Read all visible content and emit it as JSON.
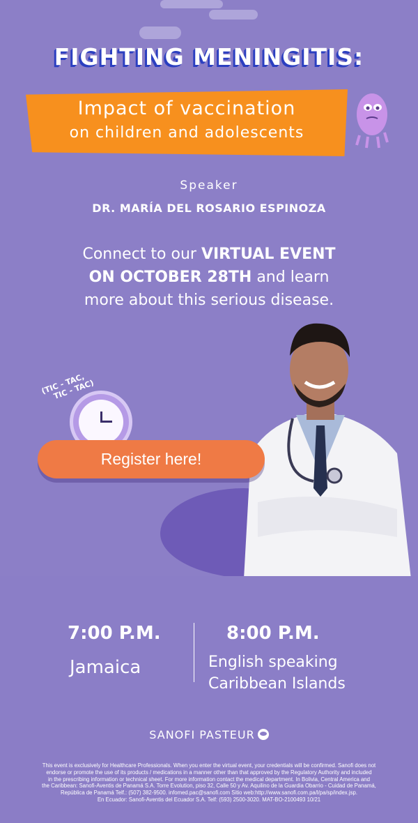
{
  "header": {
    "title": "FIGHTING MENINGITIS:",
    "subtitle_line1": "Impact of vaccination",
    "subtitle_line2": "on children and adolescents"
  },
  "speaker": {
    "label": "Speaker",
    "name": "DR. MARÍA DEL ROSARIO ESPINOZA"
  },
  "invite": {
    "part1": "Connect to our ",
    "bold1": "VIRTUAL EVENT",
    "bold2": "ON OCTOBER 28TH",
    "part2": " and learn",
    "part3": "more about this serious disease."
  },
  "clock": {
    "tictac_line1": "(TIC - TAC,",
    "tictac_line2": "TIC - TAC)"
  },
  "cta": {
    "register_label": "Register here!"
  },
  "schedule": {
    "time1": "7:00 P.M.",
    "location1": "Jamaica",
    "time2": "8:00 P.M.",
    "location2_line1": "English speaking",
    "location2_line2": "Caribbean Islands"
  },
  "brand": {
    "name": "SANOFI PASTEUR"
  },
  "footer": {
    "disclaimer_lines": [
      "This event is exclusively for Healthcare Professionals. When you enter the virtual event, your credentials will be confirmed. Sanofi does not",
      "endorse or promote the use of its products / medications in a manner other than that approved by the Regulatory Authority and included",
      "in the prescribing information or technical sheet. For more information contact the medical department. In Bolivia, Central America and",
      "the Caribbean: Sanofi-Aventis de Panamá S.A. Torre Evolution, piso 32, Calle 50 y Av. Aquilino de la Guardia Obarrio - Cuidad de Panamá,",
      "República de Panamá Telf.: (507) 382-9500. infomed.pac@sanofi.com Sitio web:http://www.sanofi.com.pa/l/pa/sp/index.jsp.",
      "En Ecuador: Sanofi-Aventis del Ecuador S.A.  Telf: (593) 2500-3020. MAT-BO-2100493 10/21"
    ]
  },
  "colors": {
    "background": "#8c7fc7",
    "banner": "#f7901e",
    "title_shadow": "#2b3fc0",
    "button": "#ef7a45"
  }
}
